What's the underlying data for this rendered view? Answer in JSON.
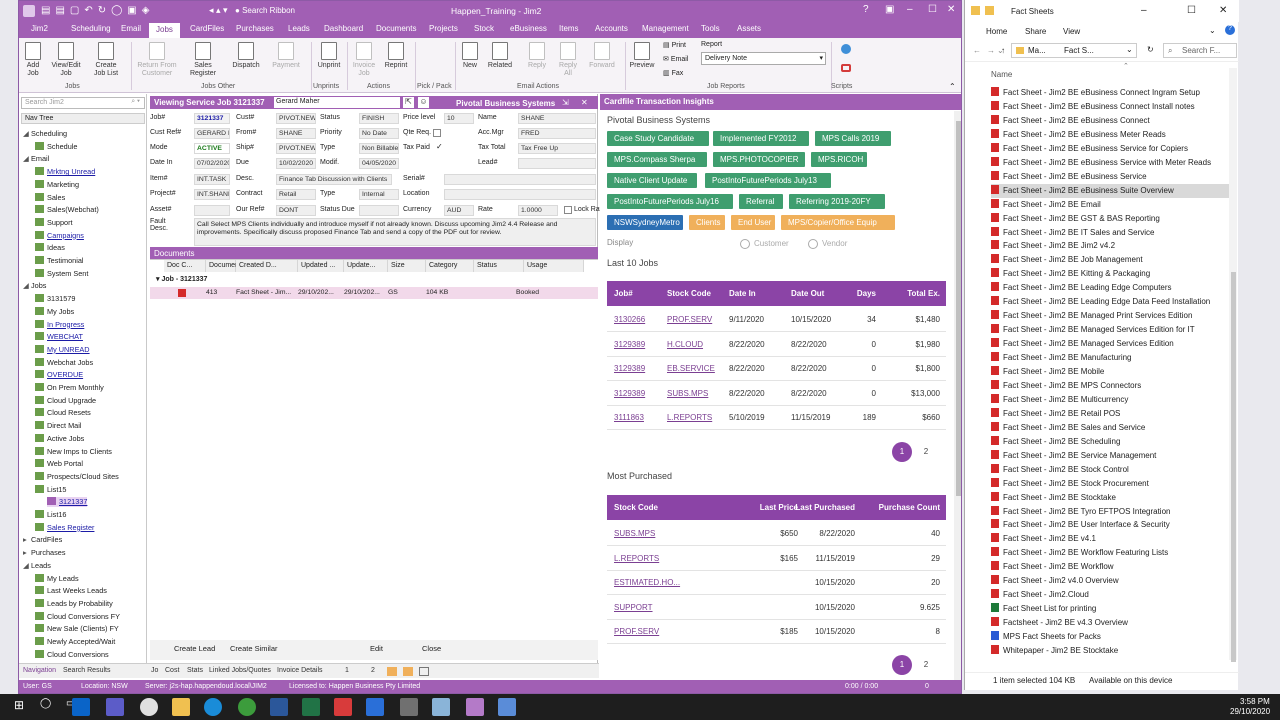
{
  "app": {
    "title": "Happen_Training - Jim2",
    "search_ribbon": "Search Ribbon",
    "tabs": [
      "Jim2",
      "Scheduling",
      "Email",
      "Jobs",
      "CardFiles",
      "Purchases",
      "Leads",
      "Dashboard",
      "Documents",
      "Projects",
      "Stock",
      "eBusiness",
      "Items",
      "Accounts",
      "Management",
      "Tools",
      "Assets"
    ],
    "ribbon": {
      "buttons": [
        "Add Job",
        "View/Edit Job",
        "Create Job List",
        "Return From Customer",
        "Sales Register",
        "Dispatch",
        "Payment",
        "Unprint",
        "Invoice Job",
        "Reprint",
        "New",
        "Related",
        "Reply",
        "Reply All",
        "Forward",
        "Preview"
      ],
      "groups": [
        "Jobs",
        "Jobs Other",
        "Unprints",
        "Actions",
        "Pick / Pack",
        "Email Actions",
        "Job Reports",
        "Scripts"
      ],
      "print": "Print",
      "email": "Email",
      "fax": "Fax",
      "report_label": "Report",
      "report_value": "Delivery Note"
    }
  },
  "nav": {
    "search_placeholder": "Search Jim2",
    "tree_header": "Nav Tree",
    "items": [
      "Scheduling",
      "Schedule",
      "Email",
      "Mrktng Unread",
      "Marketing",
      "Sales",
      "Sales(Webchat)",
      "Support",
      "Campaigns",
      "Ideas",
      "Testimonial",
      "System Sent",
      "Jobs",
      "3131579",
      "My Jobs",
      "In Progress",
      "WEBCHAT",
      "My UNREAD",
      "Webchat Jobs",
      "OVERDUE",
      "On Prem Monthly",
      "Cloud Upgrade",
      "Cloud Resets",
      "Direct Mail",
      "Active Jobs",
      "New Imps to Clients",
      "Web Portal",
      "Prospects/Cloud Sites",
      "List15",
      "3121337",
      "List16",
      "Sales Register",
      "CardFiles",
      "Purchases",
      "Leads",
      "My Leads",
      "Last Weeks Leads",
      "Leads by Probability",
      "Cloud Conversions FY",
      "New Sale (Clients) FY",
      "Newly Accepted/Wait",
      "Cloud Conversions"
    ]
  },
  "job": {
    "header": "Viewing Service Job 3121337",
    "owner": "Gerard Maher",
    "company": "Pivotal Business Systems",
    "labels": [
      "Job#",
      "Cust#",
      "Status",
      "Price level",
      "Name",
      "Cust Ref#",
      "From#",
      "Priority",
      "Qte Req.",
      "Acc.Mgr",
      "Mode",
      "Ship#",
      "Type",
      "Tax Paid",
      "Tax Total",
      "Date In",
      "Due",
      "Modif.",
      "Lead#",
      "Item#",
      "Desc.",
      "Serial#",
      "Project#",
      "Contract",
      "Type",
      "Location",
      "Asset#",
      "Our Ref#",
      "Status Due",
      "Currency",
      "Rate",
      "Lock Rate",
      "Fault Desc."
    ],
    "values": {
      "job": "3121337",
      "cust": "PIVOT.NEW",
      "status": "FINISH",
      "price_level": "10",
      "name": "SHANE",
      "custref": "GERARD M",
      "from": "SHANE",
      "priority": "No Date",
      "accmgr": "FRED",
      "mode": "ACTIVE",
      "ship": "PIVOT.NEW",
      "type": "Non Billable",
      "taxtotal": "Tax Free Up",
      "datein": "07/02/2020",
      "due": "10/02/2020",
      "modif": "04/05/2020",
      "item": "INT.TASK",
      "desc": "Finance Tab Discussion with Clients",
      "project": "INT.SHANE",
      "contract": "Retail",
      "type2": "Internal",
      "ourref": "DONT",
      "currency": "AUD",
      "rate": "1.0000"
    },
    "fault": "Call Select MPS Clients individually and introduce myself if not already known. Discuss upcoming Jim2 4.4 Release and improvements. Specifically discuss proposed Finance Tab and send a copy of the PDF out for review.",
    "documents_label": "Documents",
    "doc_columns": [
      "Doc C...",
      "Document",
      "Created D...",
      "Updated ...",
      "Update...",
      "Size",
      "Category",
      "Status",
      "Usage"
    ],
    "group_row": "Job - 3121337",
    "doc_row": [
      "413",
      "Fact Sheet - Jim...",
      "29/10/202...",
      "29/10/202...",
      "GS",
      "104 KB",
      "",
      "Booked",
      ""
    ],
    "buttons": [
      "Create Lead",
      "Create Similar",
      "Edit",
      "Close"
    ],
    "bottom_tabs": [
      "Navigation",
      "Search Results",
      "Jo",
      "Cost",
      "Stats",
      "Linked Jobs/Quotes",
      "Invoice Details",
      "1",
      "2"
    ]
  },
  "status": {
    "user": "User: GS",
    "location": "Location: NSW",
    "server": "Server: j2s-hap.happendoud.local\\JIM2",
    "license": "Licensed to: Happen Business Pty Limited",
    "time": "0:00 / 0:00",
    "count": "0"
  },
  "insights": {
    "title": "Cardfile Transaction Insights",
    "company": "Pivotal Business Systems",
    "tags": [
      [
        "Case Study Candidate",
        "green"
      ],
      [
        "Implemented FY2012",
        "green"
      ],
      [
        "MPS Calls 2019",
        "green"
      ],
      [
        "MPS.Compass Sherpa",
        "green"
      ],
      [
        "MPS.PHOTOCOPIER",
        "green"
      ],
      [
        "MPS.RICOH",
        "green"
      ],
      [
        "Native Client Update",
        "green"
      ],
      [
        "PostIntoFuturePeriods July13",
        "green"
      ],
      [
        "PostIntoFuturePeriods July16",
        "green"
      ],
      [
        "Referral",
        "green"
      ],
      [
        "Referring 2019-20FY",
        "green"
      ],
      [
        "NSWSydneyMetro",
        "blue"
      ],
      [
        "Clients",
        "orange"
      ],
      [
        "End User",
        "orange"
      ],
      [
        "MPS/Copier/Office Equip",
        "orange"
      ]
    ],
    "display": "Display",
    "customer": "Customer",
    "vendor": "Vendor",
    "last_jobs_title": "Last 10 Jobs",
    "jobs_cols": [
      "Job#",
      "Stock Code",
      "Date In",
      "Date Out",
      "Days",
      "Total Ex."
    ],
    "jobs": [
      [
        "3130266",
        "PROF.SERV",
        "9/11/2020",
        "10/15/2020",
        "34",
        "$1,480"
      ],
      [
        "3129389",
        "H.CLOUD",
        "8/22/2020",
        "8/22/2020",
        "0",
        "$1,980"
      ],
      [
        "3129389",
        "EB.SERVICE",
        "8/22/2020",
        "8/22/2020",
        "0",
        "$1,800"
      ],
      [
        "3129389",
        "SUBS.MPS",
        "8/22/2020",
        "8/22/2020",
        "0",
        "$13,000"
      ],
      [
        "3111863",
        "L.REPORTS",
        "5/10/2019",
        "11/15/2019",
        "189",
        "$660"
      ]
    ],
    "pages": [
      "1",
      "2"
    ],
    "most_title": "Most Purchased",
    "most_cols": [
      "Stock Code",
      "Last Price",
      "Last Purchased",
      "Purchase Count"
    ],
    "most": [
      [
        "SUBS.MPS",
        "$650",
        "8/22/2020",
        "40"
      ],
      [
        "L.REPORTS",
        "$165",
        "11/15/2019",
        "29"
      ],
      [
        "ESTIMATED.HO...",
        "",
        "10/15/2020",
        "20"
      ],
      [
        "SUPPORT",
        "",
        "10/15/2020",
        "9.625"
      ],
      [
        "PROF.SERV",
        "$185",
        "10/15/2020",
        "8"
      ]
    ]
  },
  "explorer": {
    "title": "Fact Sheets",
    "menu": [
      "Home",
      "Share",
      "View"
    ],
    "addr": [
      "Ma...",
      "Fact S..."
    ],
    "search": "Search F...",
    "col": "Name",
    "files": [
      [
        "Fact Sheet - Jim2 BE eBusiness Connect Ingram Setup",
        "pdf"
      ],
      [
        "Fact Sheet - Jim2 BE eBusiness Connect Install notes",
        "pdf"
      ],
      [
        "Fact Sheet - Jim2 BE eBusiness Connect",
        "pdf"
      ],
      [
        "Fact Sheet - Jim2 BE eBusiness Meter Reads",
        "pdf"
      ],
      [
        "Fact Sheet - Jim2 BE eBusiness Service for Copiers",
        "pdf"
      ],
      [
        "Fact Sheet - Jim2 BE eBusiness Service with Meter Reads",
        "pdf"
      ],
      [
        "Fact Sheet - Jim2 BE eBusiness Service",
        "pdf"
      ],
      [
        "Fact Sheet - Jim2 BE eBusiness Suite Overview",
        "pdf"
      ],
      [
        "Fact Sheet - Jim2 BE Email",
        "pdf"
      ],
      [
        "Fact Sheet - Jim2 BE GST & BAS Reporting",
        "pdf"
      ],
      [
        "Fact Sheet - Jim2 BE IT Sales and Service",
        "pdf"
      ],
      [
        "Fact Sheet - Jim2 BE Jim2 v4.2",
        "pdf"
      ],
      [
        "Fact Sheet - Jim2 BE Job Management",
        "pdf"
      ],
      [
        "Fact Sheet - Jim2 BE Kitting & Packaging",
        "pdf"
      ],
      [
        "Fact Sheet - Jim2 BE Leading Edge Computers",
        "pdf"
      ],
      [
        "Fact Sheet - Jim2 BE Leading Edge Data Feed Installation",
        "pdf"
      ],
      [
        "Fact Sheet - Jim2 BE Managed Print Services Edition",
        "pdf"
      ],
      [
        "Fact Sheet - Jim2 BE Managed Services Edition for IT",
        "pdf"
      ],
      [
        "Fact Sheet - Jim2 BE Managed Services Edition",
        "pdf"
      ],
      [
        "Fact Sheet - Jim2 BE Manufacturing",
        "pdf"
      ],
      [
        "Fact Sheet - Jim2 BE Mobile",
        "pdf"
      ],
      [
        "Fact Sheet - Jim2 BE MPS Connectors",
        "pdf"
      ],
      [
        "Fact Sheet - Jim2 BE Multicurrency",
        "pdf"
      ],
      [
        "Fact Sheet - Jim2 BE Retail POS",
        "pdf"
      ],
      [
        "Fact Sheet - Jim2 BE Sales and Service",
        "pdf"
      ],
      [
        "Fact Sheet - Jim2 BE Scheduling",
        "pdf"
      ],
      [
        "Fact Sheet - Jim2 BE Service Management",
        "pdf"
      ],
      [
        "Fact Sheet - Jim2 BE Stock Control",
        "pdf"
      ],
      [
        "Fact Sheet - Jim2 BE Stock Procurement",
        "pdf"
      ],
      [
        "Fact Sheet - Jim2 BE Stocktake",
        "pdf"
      ],
      [
        "Fact Sheet - Jim2 BE Tyro EFTPOS Integration",
        "pdf"
      ],
      [
        "Fact Sheet - Jim2 BE User Interface & Security",
        "pdf"
      ],
      [
        "Fact Sheet - Jim2 BE v4.1",
        "pdf"
      ],
      [
        "Fact Sheet - Jim2 BE Workflow Featuring Lists",
        "pdf"
      ],
      [
        "Fact Sheet - Jim2 BE Workflow",
        "pdf"
      ],
      [
        "Fact Sheet - Jim2 v4.0 Overview",
        "pdf"
      ],
      [
        "Fact Sheet - Jim2.Cloud",
        "pdf"
      ],
      [
        "Fact Sheet List for printing",
        "xls"
      ],
      [
        "Factsheet - Jim2 BE v4.3 Overview",
        "pdf"
      ],
      [
        "MPS Fact Sheets for Packs",
        "doc"
      ],
      [
        "Whitepaper - Jim2 BE Stocktake",
        "pdf"
      ]
    ],
    "selected": 7,
    "status": [
      "1 item selected  104 KB",
      "Available on this device"
    ]
  },
  "taskbar": {
    "time": "3:58 PM",
    "date": "29/10/2020"
  },
  "colors": {
    "accent": "#a15fb4",
    "tag_green": "#3f9e6f",
    "tag_orange": "#f0b05b",
    "tag_blue": "#2c6fb3",
    "table_header": "#8b44a6"
  }
}
